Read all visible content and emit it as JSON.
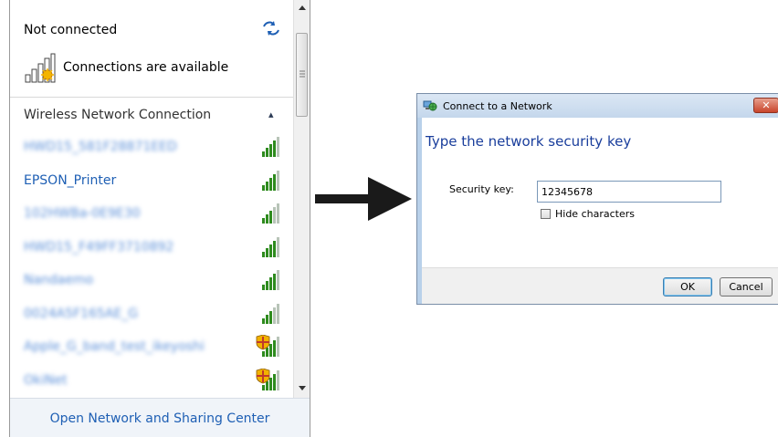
{
  "flyout": {
    "status_title": "Not connected",
    "refresh_icon": "refresh-icon",
    "availability_text": "Connections are available",
    "section_title": "Wireless Network Connection",
    "collapse_glyph": "▴",
    "networks": [
      {
        "name": "HWD15_581F28871EED",
        "blurred": true,
        "secured": false,
        "signal_bars": 4
      },
      {
        "name": "EPSON_Printer",
        "blurred": false,
        "secured": false,
        "signal_bars": 4
      },
      {
        "name": "102HWBa-0E9E30",
        "blurred": true,
        "secured": false,
        "signal_bars": 3
      },
      {
        "name": "HWD15_F49FF3710892",
        "blurred": true,
        "secured": false,
        "signal_bars": 4
      },
      {
        "name": "Nandaemo",
        "blurred": true,
        "secured": false,
        "signal_bars": 4
      },
      {
        "name": "0024A5F165AE_G",
        "blurred": true,
        "secured": false,
        "signal_bars": 3
      },
      {
        "name": "Apple_G_band_test_ikeyoshi",
        "blurred": true,
        "secured": true,
        "signal_bars": 4
      },
      {
        "name": "OkiNet",
        "blurred": true,
        "secured": true,
        "signal_bars": 4
      }
    ],
    "footer_link": "Open Network and Sharing Center"
  },
  "dialog": {
    "title": "Connect to a Network",
    "close_glyph": "✕",
    "heading": "Type the network security key",
    "security_key_label": "Security key:",
    "security_key_value": "12345678",
    "hide_characters_label": "Hide characters",
    "hide_characters_checked": false,
    "ok_label": "OK",
    "cancel_label": "Cancel"
  },
  "colors": {
    "link_blue": "#1e5fb4",
    "heading_blue": "#1a3e9c",
    "dialog_frame": "#b9d1ea",
    "signal_green": "#2e8b1e"
  }
}
